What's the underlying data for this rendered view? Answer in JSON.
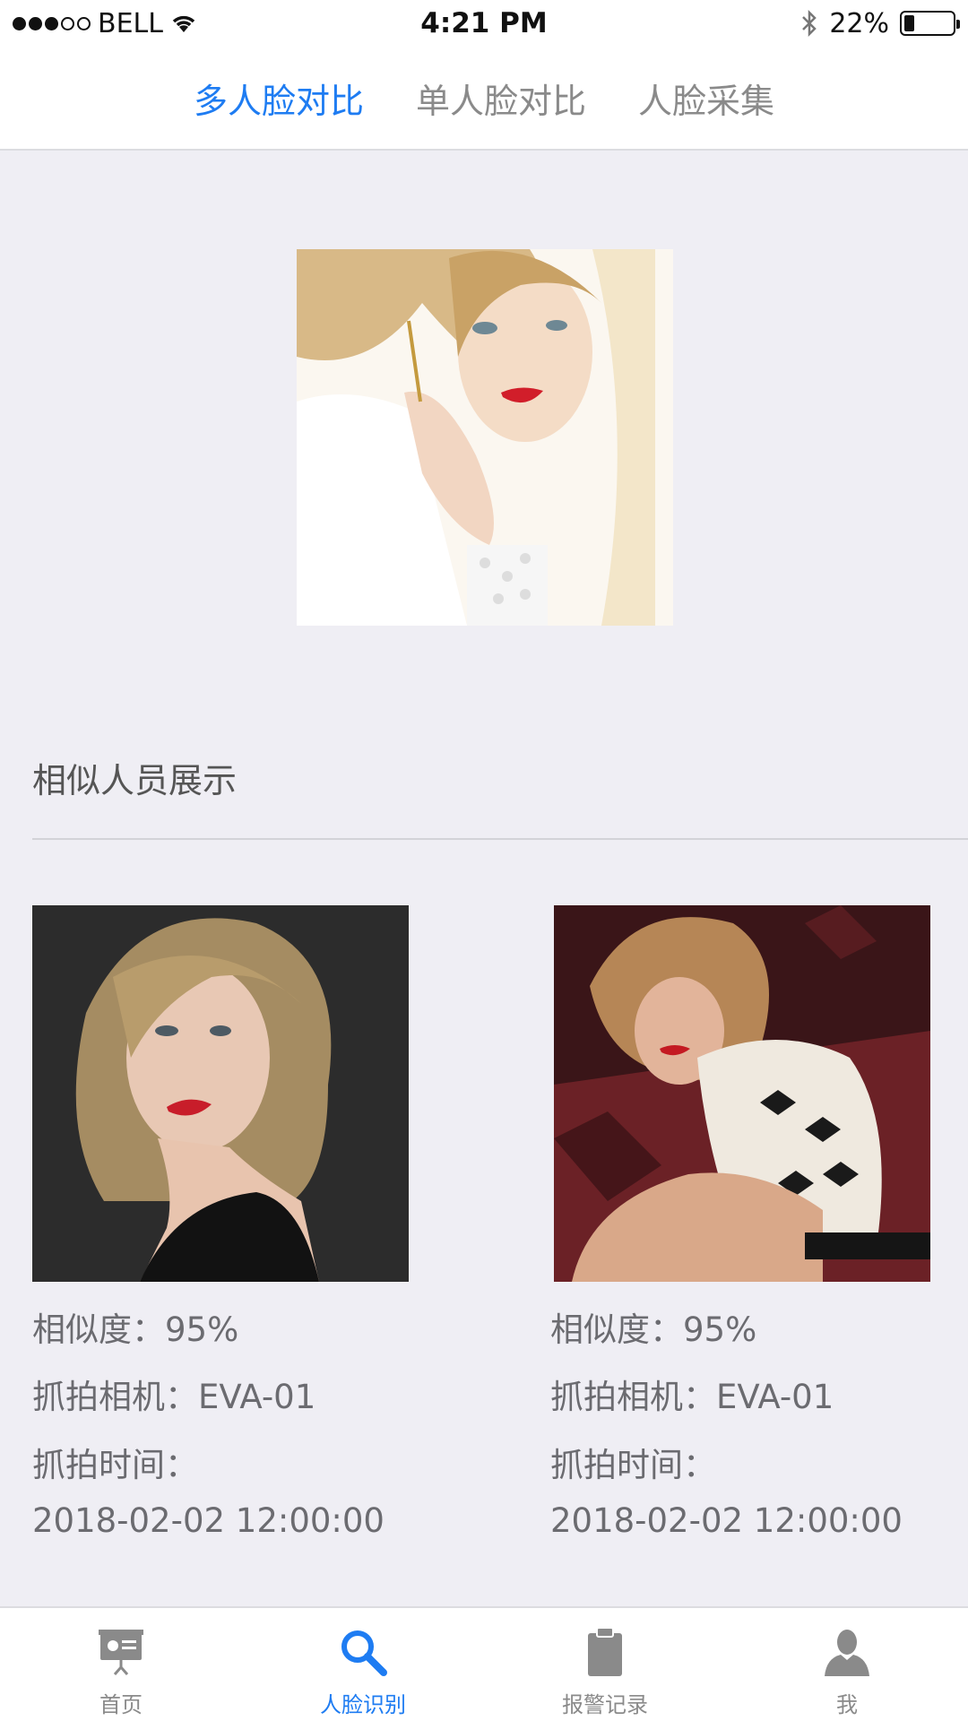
{
  "status_bar": {
    "carrier": "BELL",
    "time": "4:21 PM",
    "battery": "22%",
    "battery_level": 0.22
  },
  "top_tabs": [
    {
      "label": "多人脸对比",
      "active": true
    },
    {
      "label": "单人脸对比",
      "active": false
    },
    {
      "label": "人脸采集",
      "active": false
    }
  ],
  "section": {
    "title": "相似人员展示"
  },
  "results": [
    {
      "similarity": "相似度：95%",
      "camera": "抓拍相机：EVA-01",
      "time_label": "抓拍时间：",
      "time_value": "2018-02-02 12:00:00"
    },
    {
      "similarity": "相似度：95%",
      "camera": "抓拍相机：EVA-01",
      "time_label": "抓拍时间：",
      "time_value": "2018-02-02 12:00:00"
    }
  ],
  "tab_bar": [
    {
      "label": "首页",
      "icon": "presentation-board-icon",
      "active": false
    },
    {
      "label": "人脸识别",
      "icon": "search-icon",
      "active": true
    },
    {
      "label": "报警记录",
      "icon": "clipboard-icon",
      "active": false
    },
    {
      "label": "我",
      "icon": "user-icon",
      "active": false
    }
  ],
  "colors": {
    "accent": "#1e7cf2",
    "background": "#efeef4",
    "inactive": "#8a8a8a"
  }
}
